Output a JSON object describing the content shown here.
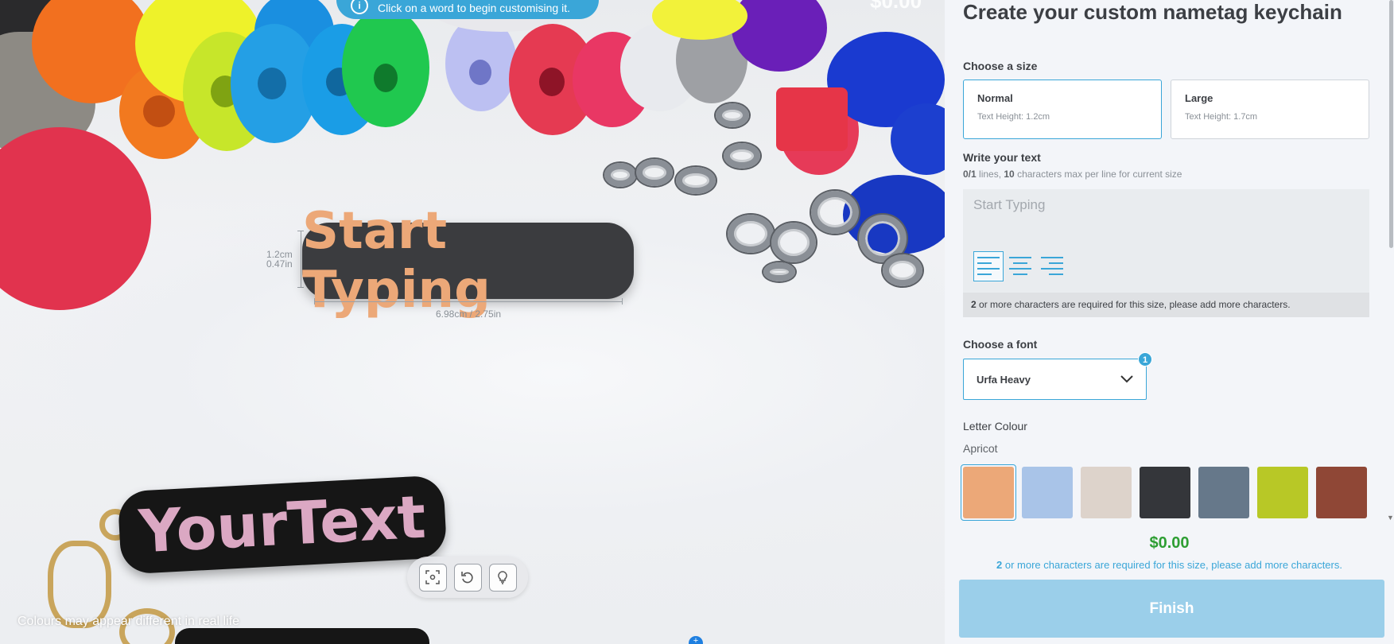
{
  "preview": {
    "info_banner": "Click on a word to begin customising it.",
    "top_price": "$0.00",
    "tag_text": "Start Typing",
    "height_dim": {
      "cm": "1.2cm",
      "in": "0.47in"
    },
    "width_dim": "6.98cm / 2.75in",
    "sample_text": "YourText",
    "disclaimer": "Colours may appear different in real life",
    "tools": [
      "focus-icon",
      "reset-icon",
      "lightbulb-icon"
    ]
  },
  "panel": {
    "title": "Create your custom nametag keychain",
    "size_label": "Choose a size",
    "sizes": [
      {
        "name": "Normal",
        "sub": "Text Height: 1.2cm",
        "selected": true
      },
      {
        "name": "Large",
        "sub": "Text Height: 1.7cm",
        "selected": false
      }
    ],
    "text_label": "Write your text",
    "text_hint": {
      "lines": "0/1",
      "lines_suffix": " lines, ",
      "chars": "10",
      "chars_suffix": " characters max per line for current size"
    },
    "text_value": "",
    "text_placeholder": "Start Typing",
    "align_buttons": [
      "align-left-icon",
      "align-center-icon",
      "align-right-icon"
    ],
    "warning": {
      "count": "2",
      "text": " or more characters are required for this size, please add more characters."
    },
    "font_label": "Choose a font",
    "font_selected": "Urfa Heavy",
    "font_badge": "1",
    "colour_label": "Letter Colour",
    "colour_selected": "Apricot",
    "colours": [
      "#eca878",
      "#a9c4e8",
      "#ddd3cb",
      "#34363a",
      "#66788a",
      "#b8c826",
      "#8f4736"
    ],
    "price": "$0.00",
    "price_note": {
      "count": "2",
      "text": " or more characters are required for this size, please add more characters."
    },
    "finish_label": "Finish"
  },
  "colors": {
    "accent": "#3aa6d8",
    "price_green": "#2e9e33",
    "finish_disabled": "#9bcfea"
  }
}
